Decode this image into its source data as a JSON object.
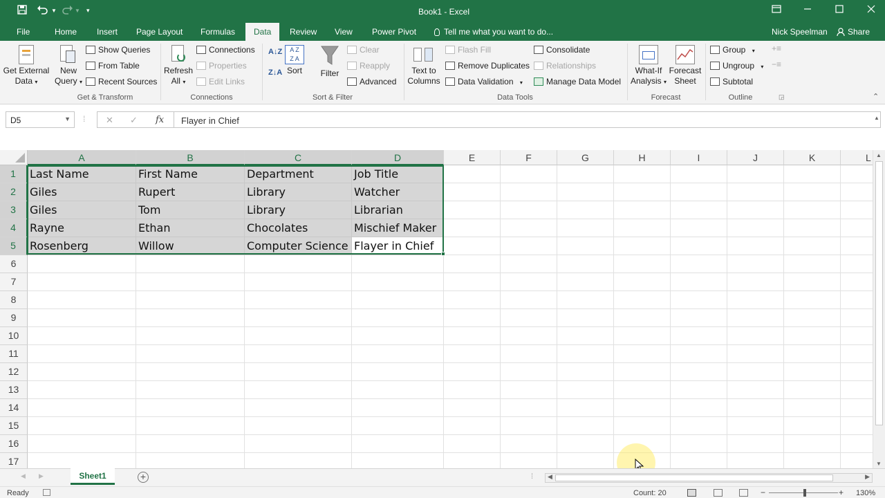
{
  "window": {
    "title": "Book1 - Excel",
    "user": "Nick Speelman",
    "share_label": "Share",
    "tell_me": "Tell me what you want to do..."
  },
  "tabs": [
    {
      "label": "File"
    },
    {
      "label": "Home"
    },
    {
      "label": "Insert"
    },
    {
      "label": "Page Layout"
    },
    {
      "label": "Formulas"
    },
    {
      "label": "Data",
      "active": true
    },
    {
      "label": "Review"
    },
    {
      "label": "View"
    },
    {
      "label": "Power Pivot"
    }
  ],
  "ribbon": {
    "get_transform": {
      "label": "Get & Transform",
      "get_external_1": "Get External",
      "get_external_2": "Data",
      "new_query_1": "New",
      "new_query_2": "Query",
      "show_queries": "Show Queries",
      "from_table": "From Table",
      "recent_sources": "Recent Sources"
    },
    "connections": {
      "label": "Connections",
      "refresh_1": "Refresh",
      "refresh_2": "All",
      "connections": "Connections",
      "properties": "Properties",
      "edit_links": "Edit Links"
    },
    "sort_filter": {
      "label": "Sort & Filter",
      "sort": "Sort",
      "filter": "Filter",
      "clear": "Clear",
      "reapply": "Reapply",
      "advanced": "Advanced"
    },
    "data_tools": {
      "label": "Data Tools",
      "text_to_columns_1": "Text to",
      "text_to_columns_2": "Columns",
      "flash_fill": "Flash Fill",
      "remove_duplicates": "Remove Duplicates",
      "data_validation": "Data Validation",
      "consolidate": "Consolidate",
      "relationships": "Relationships",
      "manage_data_model": "Manage Data Model"
    },
    "forecast": {
      "label": "Forecast",
      "what_if_1": "What-If",
      "what_if_2": "Analysis",
      "forecast_sheet_1": "Forecast",
      "forecast_sheet_2": "Sheet"
    },
    "outline": {
      "label": "Outline",
      "group": "Group",
      "ungroup": "Ungroup",
      "subtotal": "Subtotal"
    }
  },
  "formula_bar": {
    "name_box": "D5",
    "value": "Flayer in Chief"
  },
  "columns": [
    "A",
    "B",
    "C",
    "D",
    "E",
    "F",
    "G",
    "H",
    "I",
    "J",
    "K",
    "L"
  ],
  "rows": [
    "1",
    "2",
    "3",
    "4",
    "5",
    "6",
    "7",
    "8",
    "9",
    "10",
    "11",
    "12",
    "13",
    "14",
    "15",
    "16",
    "17"
  ],
  "cells": [
    [
      "Last Name",
      "First Name",
      "Department",
      "Job Title"
    ],
    [
      "Giles",
      "Rupert",
      "Library",
      "Watcher"
    ],
    [
      "Giles",
      "Tom",
      "Library",
      "Librarian"
    ],
    [
      "Rayne",
      "Ethan",
      "Chocolates",
      "Mischief Maker"
    ],
    [
      "Rosenberg",
      "Willow",
      "Computer Science",
      "Flayer in Chief"
    ]
  ],
  "sheets": [
    "Sheet1"
  ],
  "status": {
    "ready": "Ready",
    "count": "Count: 20",
    "zoom": "130%"
  },
  "accent_color": "#217346"
}
